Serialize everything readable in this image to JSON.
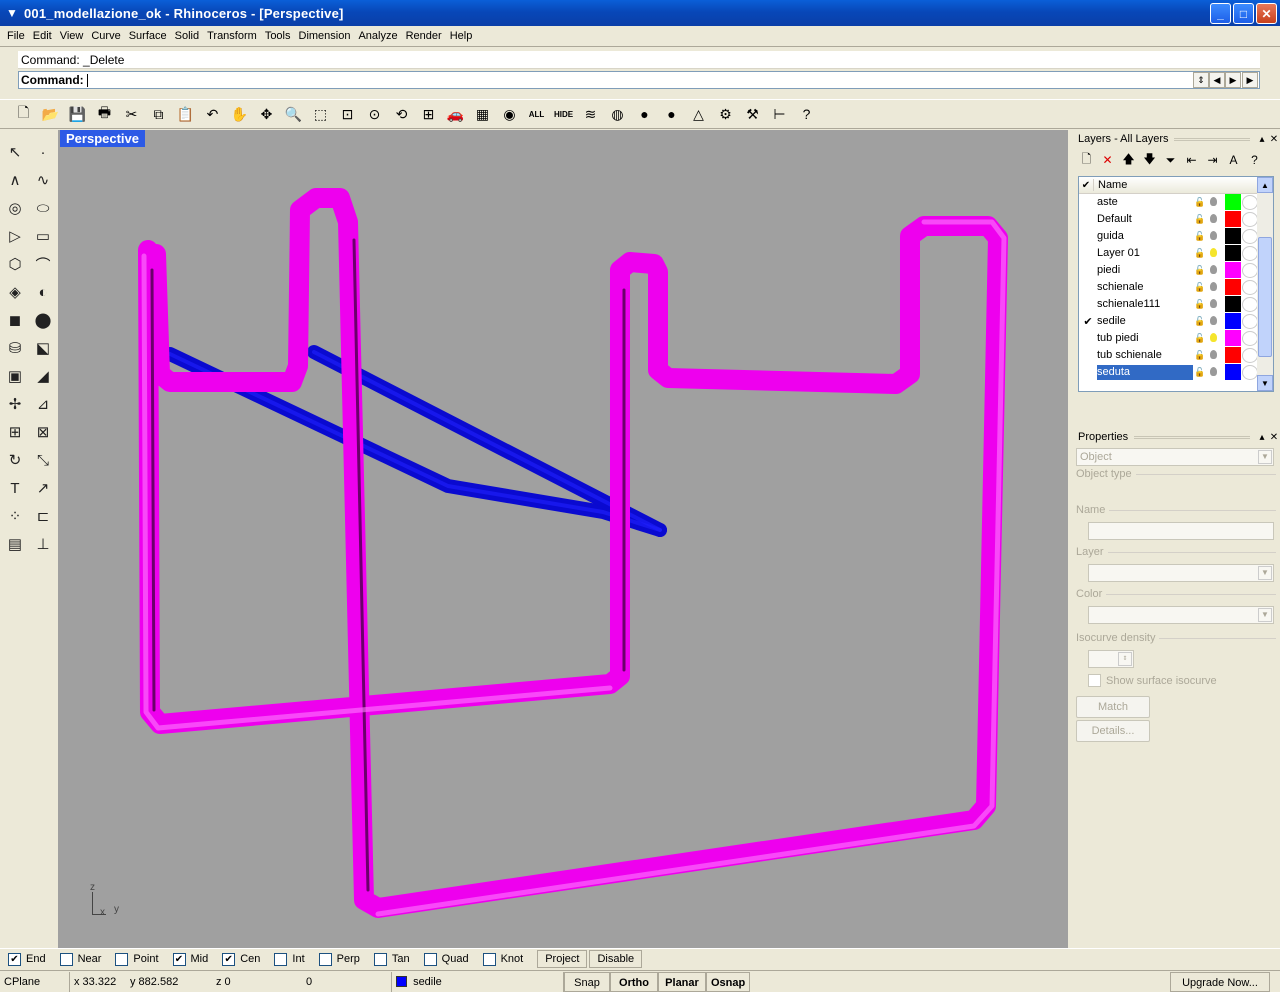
{
  "window": {
    "title": "001_modellazione_ok - Rhinoceros - [Perspective]",
    "controls": {
      "minimize": "_",
      "maximize": "□",
      "close": "✕"
    }
  },
  "menu": [
    "File",
    "Edit",
    "View",
    "Curve",
    "Surface",
    "Solid",
    "Transform",
    "Tools",
    "Dimension",
    "Analyze",
    "Render",
    "Help"
  ],
  "command": {
    "history": "Command: _Delete",
    "prompt_label": "Command:",
    "value": ""
  },
  "toolbar": {
    "items": [
      {
        "name": "new-icon",
        "glyph": "🗋"
      },
      {
        "name": "open-icon",
        "glyph": "📂"
      },
      {
        "name": "save-icon",
        "glyph": "💾"
      },
      {
        "name": "print-icon",
        "glyph": "🖶"
      },
      {
        "name": "cut-icon",
        "glyph": "✂"
      },
      {
        "name": "copy-icon",
        "glyph": "⧉"
      },
      {
        "name": "paste-icon",
        "glyph": "📋"
      },
      {
        "name": "undo-icon",
        "glyph": "↶"
      },
      {
        "name": "pan-icon",
        "glyph": "✋"
      },
      {
        "name": "rotate-view-icon",
        "glyph": "✥"
      },
      {
        "name": "zoom-icon",
        "glyph": "🔍"
      },
      {
        "name": "zoom-window-icon",
        "glyph": "⬚"
      },
      {
        "name": "zoom-extents-icon",
        "glyph": "⊡"
      },
      {
        "name": "zoom-selected-icon",
        "glyph": "⊙"
      },
      {
        "name": "zoom-previous-icon",
        "glyph": "⟲"
      },
      {
        "name": "four-viewports-icon",
        "glyph": "⊞"
      },
      {
        "name": "named-views-icon",
        "glyph": "🚗"
      },
      {
        "name": "cplane-icon",
        "glyph": "▦"
      },
      {
        "name": "show-object-icon",
        "glyph": "◉"
      }
    ],
    "all_label": "ALL",
    "hide_label": "HIDE",
    "items2": [
      {
        "name": "layer-icon",
        "glyph": "≋"
      },
      {
        "name": "color-wheel-icon",
        "glyph": "◍"
      },
      {
        "name": "render-sphere-icon",
        "glyph": "●"
      },
      {
        "name": "shaded-sphere-icon",
        "glyph": "●"
      },
      {
        "name": "light-icon",
        "glyph": "△"
      },
      {
        "name": "options-icon",
        "glyph": "⚙"
      },
      {
        "name": "snap-settings-icon",
        "glyph": "⚒"
      },
      {
        "name": "dimension-icon",
        "glyph": "⊢"
      },
      {
        "name": "help-icon",
        "glyph": "?"
      }
    ]
  },
  "left_toolbar": [
    {
      "name": "select-arrow-icon",
      "glyph": "↖"
    },
    {
      "name": "point-icon",
      "glyph": "·"
    },
    {
      "name": "polyline-icon",
      "glyph": "∧"
    },
    {
      "name": "curve-icon",
      "glyph": "∿"
    },
    {
      "name": "circle-icon",
      "glyph": "◎"
    },
    {
      "name": "ellipse-icon",
      "glyph": "⬭"
    },
    {
      "name": "polygon-icon",
      "glyph": "▷"
    },
    {
      "name": "rectangle-icon",
      "glyph": "▭"
    },
    {
      "name": "hexagon-icon",
      "glyph": "⬡"
    },
    {
      "name": "arc-icon",
      "glyph": "⌒"
    },
    {
      "name": "surface-icon",
      "glyph": "◈"
    },
    {
      "name": "revolve-icon",
      "glyph": "◐"
    },
    {
      "name": "box-icon",
      "glyph": "◼"
    },
    {
      "name": "boolean-icon",
      "glyph": "⬤"
    },
    {
      "name": "cylinder-icon",
      "glyph": "⛁"
    },
    {
      "name": "mesh-icon",
      "glyph": "⬕"
    },
    {
      "name": "explode-icon",
      "glyph": "▣"
    },
    {
      "name": "fillet-icon",
      "glyph": "◢"
    },
    {
      "name": "move-icon",
      "glyph": "✢"
    },
    {
      "name": "mirror-icon",
      "glyph": "⊿"
    },
    {
      "name": "array-icon",
      "glyph": "⊞"
    },
    {
      "name": "scale-icon",
      "glyph": "⊠"
    },
    {
      "name": "rotate-icon",
      "glyph": "↻"
    },
    {
      "name": "transform-icon",
      "glyph": "⤡"
    },
    {
      "name": "text-icon",
      "glyph": "T"
    },
    {
      "name": "dim-icon",
      "glyph": "↗"
    },
    {
      "name": "grid-icon",
      "glyph": "⁘"
    },
    {
      "name": "analyze-icon",
      "glyph": "⊏"
    },
    {
      "name": "render-icon",
      "glyph": "▤"
    },
    {
      "name": "ground-icon",
      "glyph": "⊥"
    }
  ],
  "viewport": {
    "label": "Perspective",
    "background": "#a0a0a0",
    "axis_labels": {
      "z": "z",
      "x": "x",
      "y": "y"
    },
    "object_colors": {
      "magenta": "#ee00ee",
      "blue": "#0a0ad0"
    }
  },
  "layers_panel": {
    "title": "Layers - All Layers",
    "column_header": "Name",
    "rows": [
      {
        "name": "aste",
        "current": false,
        "selected": false,
        "light_on": false,
        "color": "#00ff00"
      },
      {
        "name": "Default",
        "current": false,
        "selected": false,
        "light_on": false,
        "color": "#ff0000"
      },
      {
        "name": "guida",
        "current": false,
        "selected": false,
        "light_on": false,
        "color": "#000000"
      },
      {
        "name": "Layer 01",
        "current": false,
        "selected": false,
        "light_on": true,
        "color": "#000000"
      },
      {
        "name": "piedi",
        "current": false,
        "selected": false,
        "light_on": false,
        "color": "#ff00ff"
      },
      {
        "name": "schienale",
        "current": false,
        "selected": false,
        "light_on": false,
        "color": "#ff0000"
      },
      {
        "name": "schienale111",
        "current": false,
        "selected": false,
        "light_on": false,
        "color": "#000000"
      },
      {
        "name": "sedile",
        "current": true,
        "selected": false,
        "light_on": false,
        "color": "#0000ff"
      },
      {
        "name": "tub piedi",
        "current": false,
        "selected": false,
        "light_on": true,
        "color": "#ff00ff"
      },
      {
        "name": "tub schienale",
        "current": false,
        "selected": false,
        "light_on": false,
        "color": "#ff0000"
      },
      {
        "name": "seduta",
        "current": false,
        "selected": true,
        "light_on": false,
        "color": "#0000ff"
      }
    ]
  },
  "properties_panel": {
    "title": "Properties",
    "object_combo": "Object",
    "object_type_label": "Object type",
    "name_label": "Name",
    "layer_label": "Layer",
    "color_label": "Color",
    "isocurve_label": "Isocurve density",
    "show_isocurve_label": "Show surface isocurve",
    "match_label": "Match",
    "details_label": "Details..."
  },
  "osnap": {
    "items": [
      {
        "label": "End",
        "checked": true
      },
      {
        "label": "Near",
        "checked": false
      },
      {
        "label": "Point",
        "checked": false
      },
      {
        "label": "Mid",
        "checked": true
      },
      {
        "label": "Cen",
        "checked": true
      },
      {
        "label": "Int",
        "checked": false
      },
      {
        "label": "Perp",
        "checked": false
      },
      {
        "label": "Tan",
        "checked": false
      },
      {
        "label": "Quad",
        "checked": false
      },
      {
        "label": "Knot",
        "checked": false
      }
    ],
    "project_label": "Project",
    "disable_label": "Disable"
  },
  "status": {
    "cplane": "CPlane",
    "x": "x 33.322",
    "y": "y 882.582",
    "z": "z 0",
    "extra": "0",
    "layer": "sedile",
    "layer_color": "#0000ff",
    "snap": "Snap",
    "ortho": "Ortho",
    "planar": "Planar",
    "osnap": "Osnap",
    "upgrade": "Upgrade Now..."
  }
}
